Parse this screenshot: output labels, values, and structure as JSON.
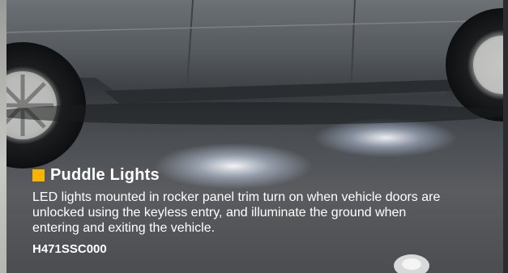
{
  "feature": {
    "title": "Puddle Lights",
    "description": "LED lights mounted in rocker panel trim turn on when vehicle doors are unlocked using the keyless entry, and illuminate the ground when entering and exiting the vehicle.",
    "part_number": "H471SSC000"
  },
  "colors": {
    "accent": "#f7b500",
    "text": "#ffffff"
  },
  "icons": {
    "title_marker": "orange-square-icon"
  }
}
